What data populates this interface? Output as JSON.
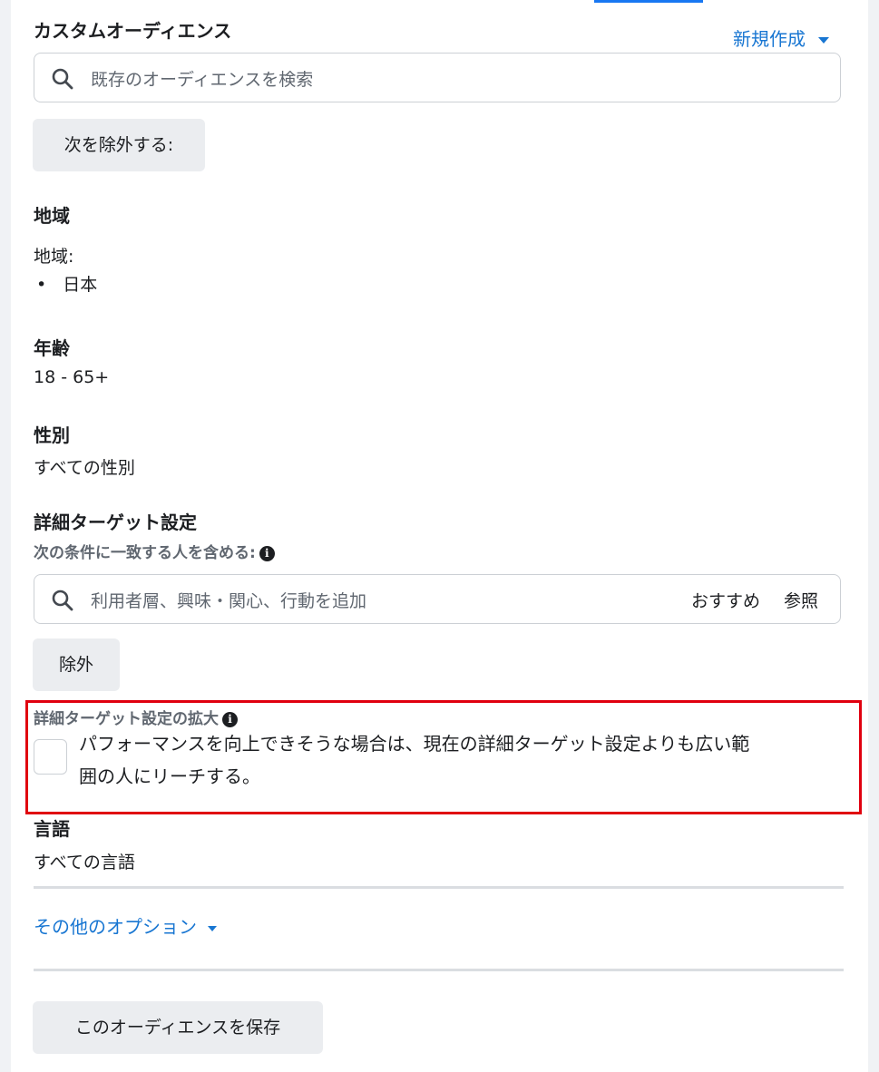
{
  "custom_audience": {
    "title": "カスタムオーディエンス",
    "create_new_label": "新規作成",
    "search_placeholder": "既存のオーディエンスを検索",
    "exclude_button_label": "次を除外する:"
  },
  "location": {
    "title": "地域",
    "label": "地域:",
    "items": [
      "日本"
    ]
  },
  "age": {
    "title": "年齢",
    "value": "18 - 65+"
  },
  "gender": {
    "title": "性別",
    "value": "すべての性別"
  },
  "detailed_targeting": {
    "title": "詳細ターゲット設定",
    "subtitle": "次の条件に一致する人を含める:",
    "search_placeholder": "利用者層、興味・関心、行動を追加",
    "suggestions_label": "おすすめ",
    "browse_label": "参照",
    "exclude_button_label": "除外"
  },
  "expansion": {
    "title": "詳細ターゲット設定の拡大",
    "checkbox_text_line1": "パフォーマンスを向上できそうな場合は、現在の詳細ターゲット設定よりも広い範",
    "checkbox_text_line2": "囲の人にリーチする。",
    "checked": false
  },
  "language": {
    "title": "言語",
    "value": "すべての言語"
  },
  "more_options_label": "その他のオプション",
  "save_audience_label": "このオーディエンスを保存",
  "colors": {
    "link": "#1876d2",
    "highlight": "#e0000f",
    "button_bg": "#ebedf0"
  },
  "icons": {
    "search": "search-icon",
    "info": "info-icon",
    "caret": "caret-down-icon"
  }
}
